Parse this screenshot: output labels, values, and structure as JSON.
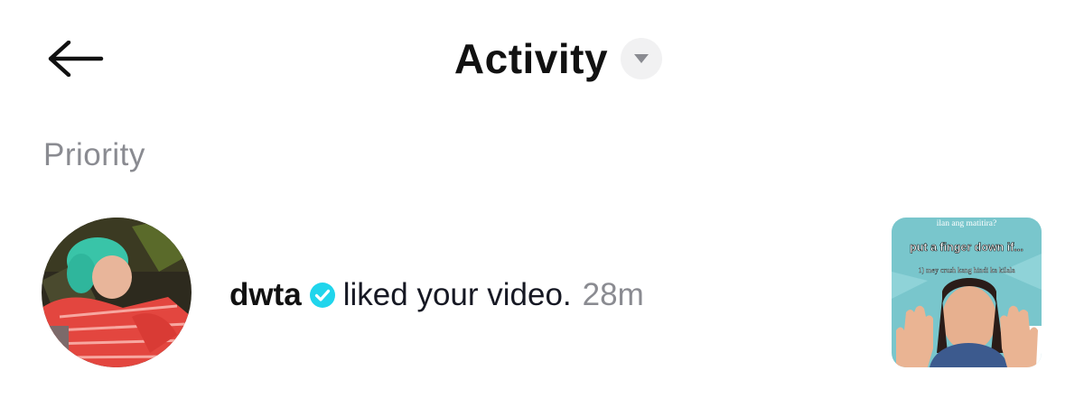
{
  "header": {
    "back_icon": "arrow-left-icon",
    "title": "Activity",
    "dropdown_icon": "caret-down-icon"
  },
  "section": {
    "label": "Priority"
  },
  "notification": {
    "username": "dwta",
    "verified_icon": "verified-badge-icon",
    "verified_color": "#20d5ec",
    "action": "liked your video.",
    "time": "28m",
    "thumbnail": {
      "line1": "ilan ang matitira?",
      "line2": "put a finger down if...",
      "line3": "1) mey crush kang hindi ka kilala"
    }
  }
}
